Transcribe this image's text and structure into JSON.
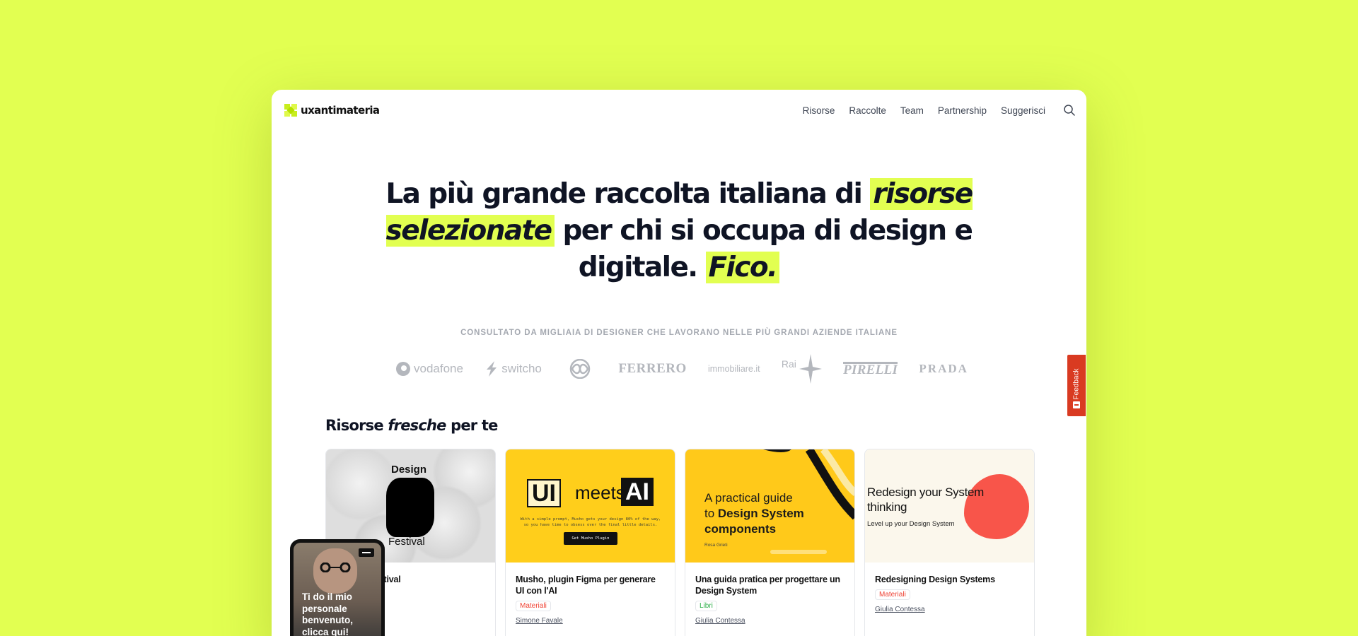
{
  "nav": {
    "logo_text": "uxantimateria",
    "items": [
      "Risorse",
      "Raccolte",
      "Team",
      "Partnership",
      "Suggerisci"
    ]
  },
  "hero": {
    "part1": "La più grande raccolta italiana di ",
    "highlight1": "risorse selezionate",
    "part2": " per chi si occupa di design e digitale. ",
    "highlight2": "Fico."
  },
  "trusted_label": "CONSULTATO DA MIGLIAIA DI DESIGNER CHE LAVORANO NELLE PIÙ GRANDI AZIENDE ITALIANE",
  "brands": [
    "vodafone",
    "switcho",
    "FERRERO",
    "immobiliare.it",
    "Rai",
    "PIRELLI",
    "PRADA"
  ],
  "section": {
    "title_a": "Risorse ",
    "title_b": "fresche",
    "title_c": " per te"
  },
  "cards": [
    {
      "title": "estival",
      "thumb": {
        "line1": "Design",
        "line2": "Festival"
      }
    },
    {
      "title": "Musho, plugin Figma per generare UI con l'AI",
      "tag": "Materiali",
      "author": "Simone Favale",
      "thumb": {
        "ui": "UI",
        "meets": "meets",
        "ai": "AI",
        "button": "Get Musho Plugin",
        "small": "With a simple prompt, Musho gets your design 80% of the way, so you have time to obsess over the final little details."
      }
    },
    {
      "title": "Una guida pratica per progettare un Design System",
      "tag": "Libri",
      "author": "Giulia Contessa",
      "thumb": {
        "line1": "A practical guide",
        "line2a": "to ",
        "line2b": "Design System",
        "line3": "components",
        "author": "Rosa Grieti"
      }
    },
    {
      "title": "Redesigning Design Systems",
      "tag": "Materiali",
      "author": "Giulia Contessa",
      "thumb": {
        "title": "Redesign your System thinking",
        "sub": "Level up your Design System"
      }
    }
  ],
  "feedback_label": "Feedback",
  "video": {
    "text": "Ti do il mio personale benvenuto, clicca qui!"
  },
  "colors": {
    "accent": "#e2ff51",
    "feedback": "#d93a21"
  }
}
